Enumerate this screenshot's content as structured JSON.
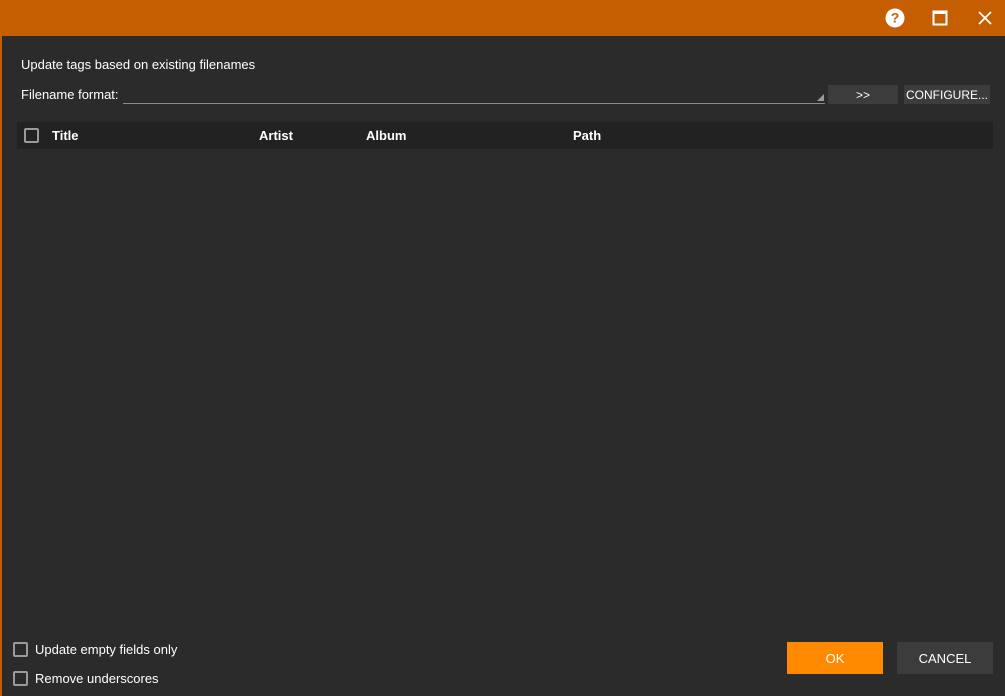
{
  "titlebar": {
    "help_icon": "help-circle-icon",
    "maximize_icon": "maximize-icon",
    "close_icon": "close-icon",
    "color": "#c55e00"
  },
  "dialog": {
    "description": "Update tags based on existing filenames",
    "format_label": "Filename format:",
    "format_value": "",
    "apply_label": ">>",
    "configure_label": "CONFIGURE..."
  },
  "table": {
    "columns": [
      "Title",
      "Artist",
      "Album",
      "Path"
    ],
    "rows": []
  },
  "options": {
    "update_empty_label": "Update empty fields only",
    "update_empty_checked": false,
    "remove_underscores_label": "Remove underscores",
    "remove_underscores_checked": false
  },
  "footer": {
    "ok_label": "OK",
    "cancel_label": "CANCEL",
    "ok_color": "#ff8a00"
  }
}
